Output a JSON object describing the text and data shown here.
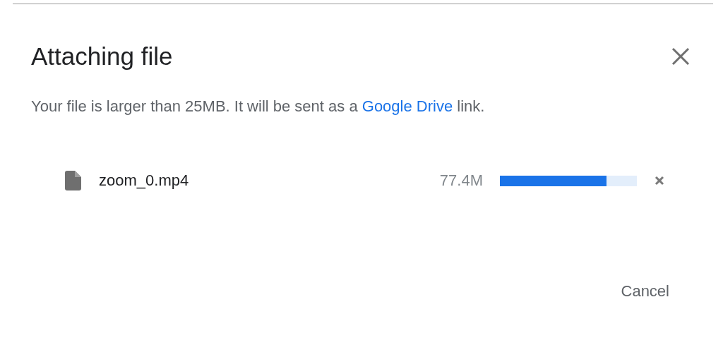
{
  "dialog": {
    "title": "Attaching file",
    "message": {
      "before": "Your file is larger than 25MB. It will be sent as a ",
      "link": "Google Drive",
      "after": " link."
    },
    "files": [
      {
        "name": "zoom_0.mp4",
        "size": "77.4M",
        "level": 0.78
      }
    ],
    "buttons": [
      "Cancel"
    ]
  }
}
